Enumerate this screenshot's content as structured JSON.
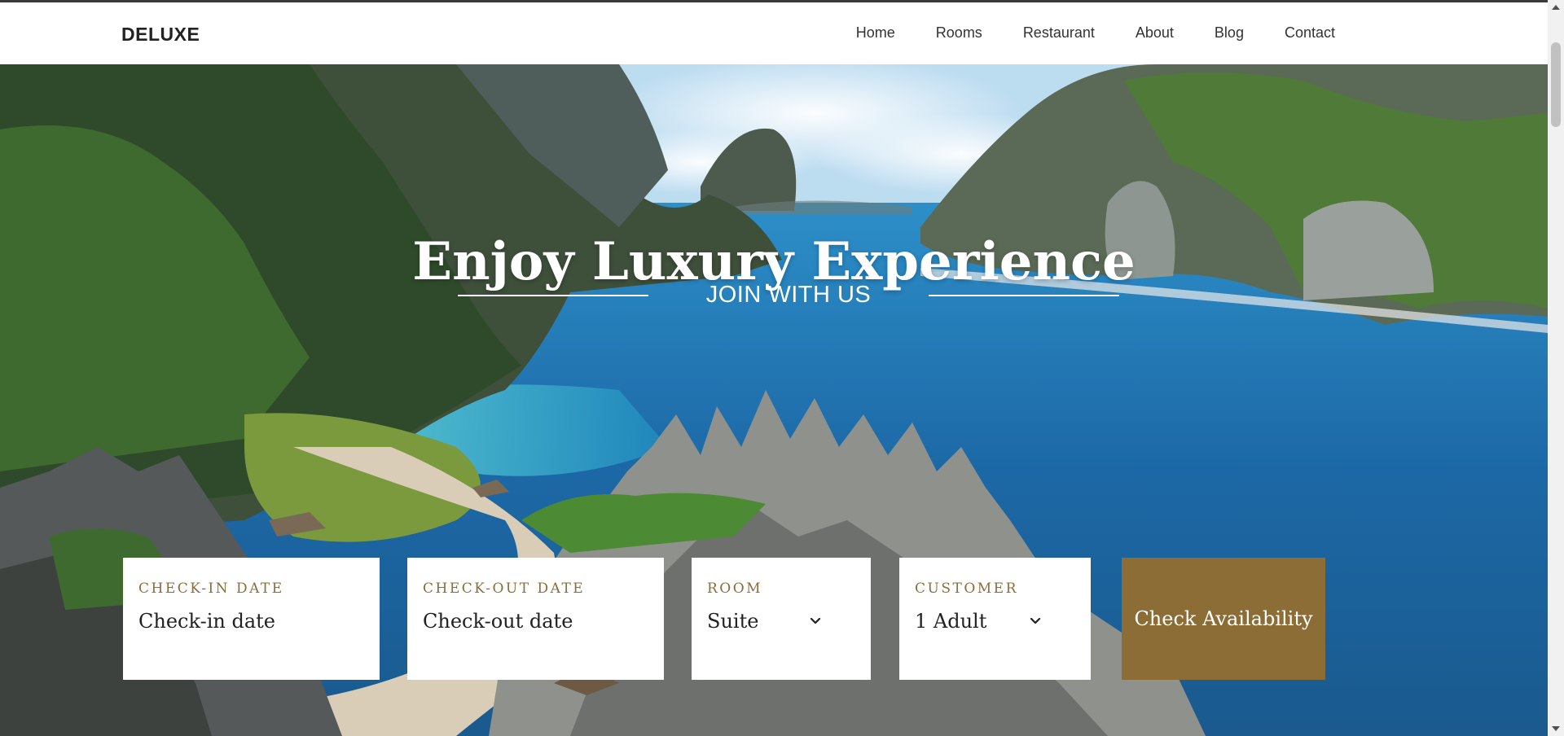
{
  "nav": {
    "brand": "DELUXE",
    "items": [
      "Home",
      "Rooms",
      "Restaurant",
      "About",
      "Blog",
      "Contact"
    ]
  },
  "hero": {
    "title": "Enjoy Luxury Experience",
    "subtitle": "JOIN WITH US"
  },
  "booking": {
    "checkin": {
      "label": "CHECK-IN DATE",
      "placeholder": "Check-in date"
    },
    "checkout": {
      "label": "CHECK-OUT DATE",
      "placeholder": "Check-out date"
    },
    "room": {
      "label": "ROOM",
      "selected": "Suite"
    },
    "customer": {
      "label": "CUSTOMER",
      "selected": "1 Adult"
    },
    "button": "Check Availability"
  },
  "colors": {
    "accent": "#8c6d36",
    "label": "#8a6d3b"
  }
}
